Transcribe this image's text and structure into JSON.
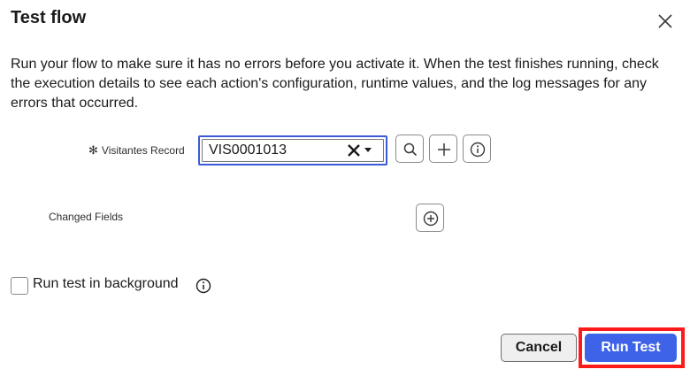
{
  "dialog": {
    "title": "Test flow",
    "description": "Run your flow to make sure it has no errors before you activate it. When the test finishes running, check the execution details to see each action's configuration, runtime values, and the log messages for any errors that occurred."
  },
  "record_field": {
    "required_mark": "✻",
    "label": "Visitantes Record",
    "value": "VIS0001013"
  },
  "changed_fields": {
    "label": "Changed Fields"
  },
  "background_option": {
    "label": "Run test in background",
    "checked": false
  },
  "footer": {
    "cancel_label": "Cancel",
    "run_label": "Run Test"
  },
  "colors": {
    "primary": "#3f63e8",
    "highlight": "#ff1a1a",
    "focus_border": "#3b5bd6"
  }
}
